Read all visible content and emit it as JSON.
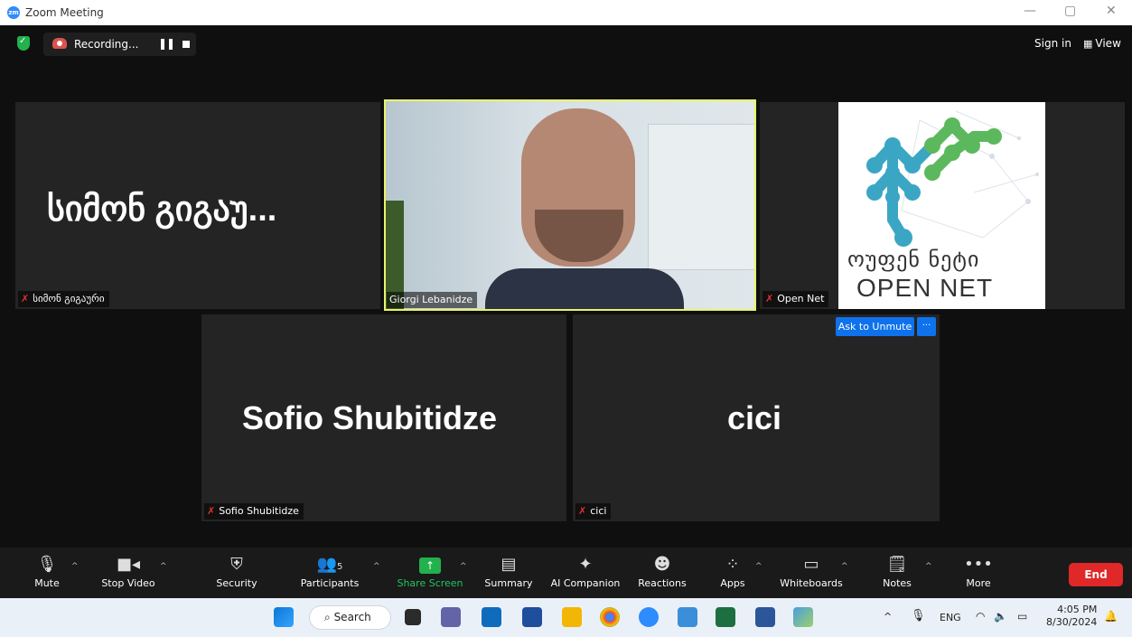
{
  "window": {
    "title": "Zoom Meeting",
    "logo_text": "zm",
    "min": "—",
    "restore": "▢",
    "close": "✕"
  },
  "topbar": {
    "recording_label": "Recording...",
    "pause_glyph": "❚❚",
    "signin_label": "Sign in",
    "view_label": "View",
    "view_icon": "grid-icon"
  },
  "tiles": {
    "t1": {
      "display_name": "სიმონ გიგაუ...",
      "tag": "სიმონ გიგაური"
    },
    "t2": {
      "tag": "Giorgi Lebanidze"
    },
    "t3": {
      "tag": "Open Net",
      "logo_geo": "ოუფენ ნეტი",
      "logo_en": "OPEN NET"
    },
    "t4": {
      "display_name": "Sofio Shubitidze",
      "tag": "Sofio Shubitidze"
    },
    "t5": {
      "display_name": "cici",
      "tag": "cici",
      "ask_unmute": "Ask to Unmute",
      "more": "···"
    }
  },
  "toolbar": {
    "mute": "Mute",
    "stop_video": "Stop Video",
    "security": "Security",
    "participants": "Participants",
    "participants_count": "5",
    "share_screen": "Share Screen",
    "summary": "Summary",
    "ai_companion": "AI Companion",
    "reactions": "Reactions",
    "apps": "Apps",
    "whiteboards": "Whiteboards",
    "notes": "Notes",
    "more": "More",
    "end": "End"
  },
  "taskbar": {
    "search": "Search",
    "lang": "ENG",
    "time": "4:05 PM",
    "date": "8/30/2024"
  },
  "colors": {
    "accent": "#0e72ed",
    "end": "#e02828",
    "share": "#22b14c",
    "speaker_border": "#e9f26a"
  }
}
